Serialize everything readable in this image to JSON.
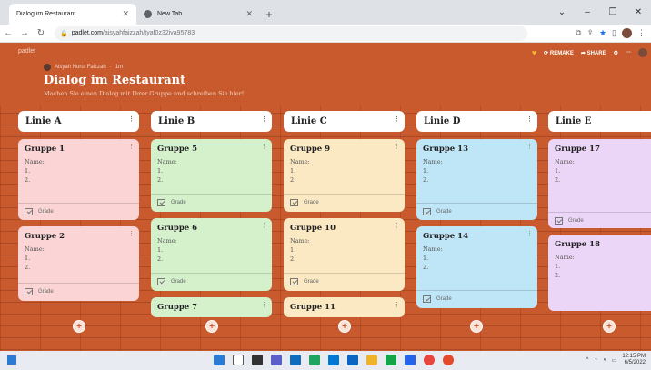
{
  "browser": {
    "tabs": [
      {
        "title": "Dialog im Restaurant",
        "active": true
      },
      {
        "title": "New Tab",
        "active": false
      }
    ],
    "url_host": "padlet.com",
    "url_path": "/aisyahfaizzah/tyaf0z32iva95783"
  },
  "padlet": {
    "brand": "padlet",
    "author": "Aisyah Nurul Faizzah",
    "age": "1m",
    "title": "Dialog im Restaurant",
    "subtitle": "Machen Sie einen Dialog mit Ihrer Gruppe und schreiben Sie hier!",
    "remake_label": "REMAKE",
    "share_label": "SHARE"
  },
  "columns": [
    {
      "title": "Linie A",
      "cards": [
        {
          "title": "Gruppe 1",
          "color": "#fbd5d5",
          "lines": [
            "Name:",
            "1.",
            "2."
          ],
          "grade": "Grade"
        },
        {
          "title": "Gruppe 2",
          "color": "#fbd5d5",
          "lines": [
            "Name:",
            "1.",
            "2."
          ],
          "grade": "Grade"
        }
      ]
    },
    {
      "title": "Linie B",
      "cards": [
        {
          "title": "Gruppe 5",
          "color": "#d4f1cc",
          "lines": [
            "Name:",
            "1.",
            "2."
          ],
          "grade": "Grade"
        },
        {
          "title": "Gruppe 6",
          "color": "#d4f1cc",
          "lines": [
            "Name:",
            "1.",
            "2."
          ],
          "grade": "Grade"
        },
        {
          "title": "Gruppe 7",
          "color": "#d4f1cc",
          "lines": [],
          "grade": ""
        }
      ]
    },
    {
      "title": "Linie C",
      "cards": [
        {
          "title": "Gruppe 9",
          "color": "#fbe9c3",
          "lines": [
            "Name:",
            "1.",
            "2."
          ],
          "grade": "Grade"
        },
        {
          "title": "Gruppe 10",
          "color": "#fbe9c3",
          "lines": [
            "Name:",
            "1.",
            "2."
          ],
          "grade": "Grade"
        },
        {
          "title": "Gruppe 11",
          "color": "#fbe9c3",
          "lines": [],
          "grade": ""
        }
      ]
    },
    {
      "title": "Linie D",
      "cards": [
        {
          "title": "Gruppe 13",
          "color": "#bfe6f7",
          "lines": [
            "Name:",
            "1.",
            "2."
          ],
          "grade": "Grade"
        },
        {
          "title": "Gruppe 14",
          "color": "#bfe6f7",
          "lines": [
            "Name:",
            "1.",
            "2."
          ],
          "grade": "Grade"
        }
      ]
    },
    {
      "title": "Linie E",
      "cards": [
        {
          "title": "Gruppe 17",
          "color": "#ecd6f7",
          "lines": [
            "Name:",
            "1.",
            "2."
          ],
          "grade": "Grade"
        },
        {
          "title": "Gruppe 18",
          "color": "#ecd6f7",
          "lines": [
            "Name:",
            "1.",
            "2."
          ],
          "grade": ""
        }
      ]
    }
  ],
  "add_button_label": "+",
  "taskbar": {
    "time": "12:15 PM",
    "date": "6/5/2022"
  },
  "colors": {
    "wall": "#c85a2e",
    "heart": "#f5b52e"
  }
}
